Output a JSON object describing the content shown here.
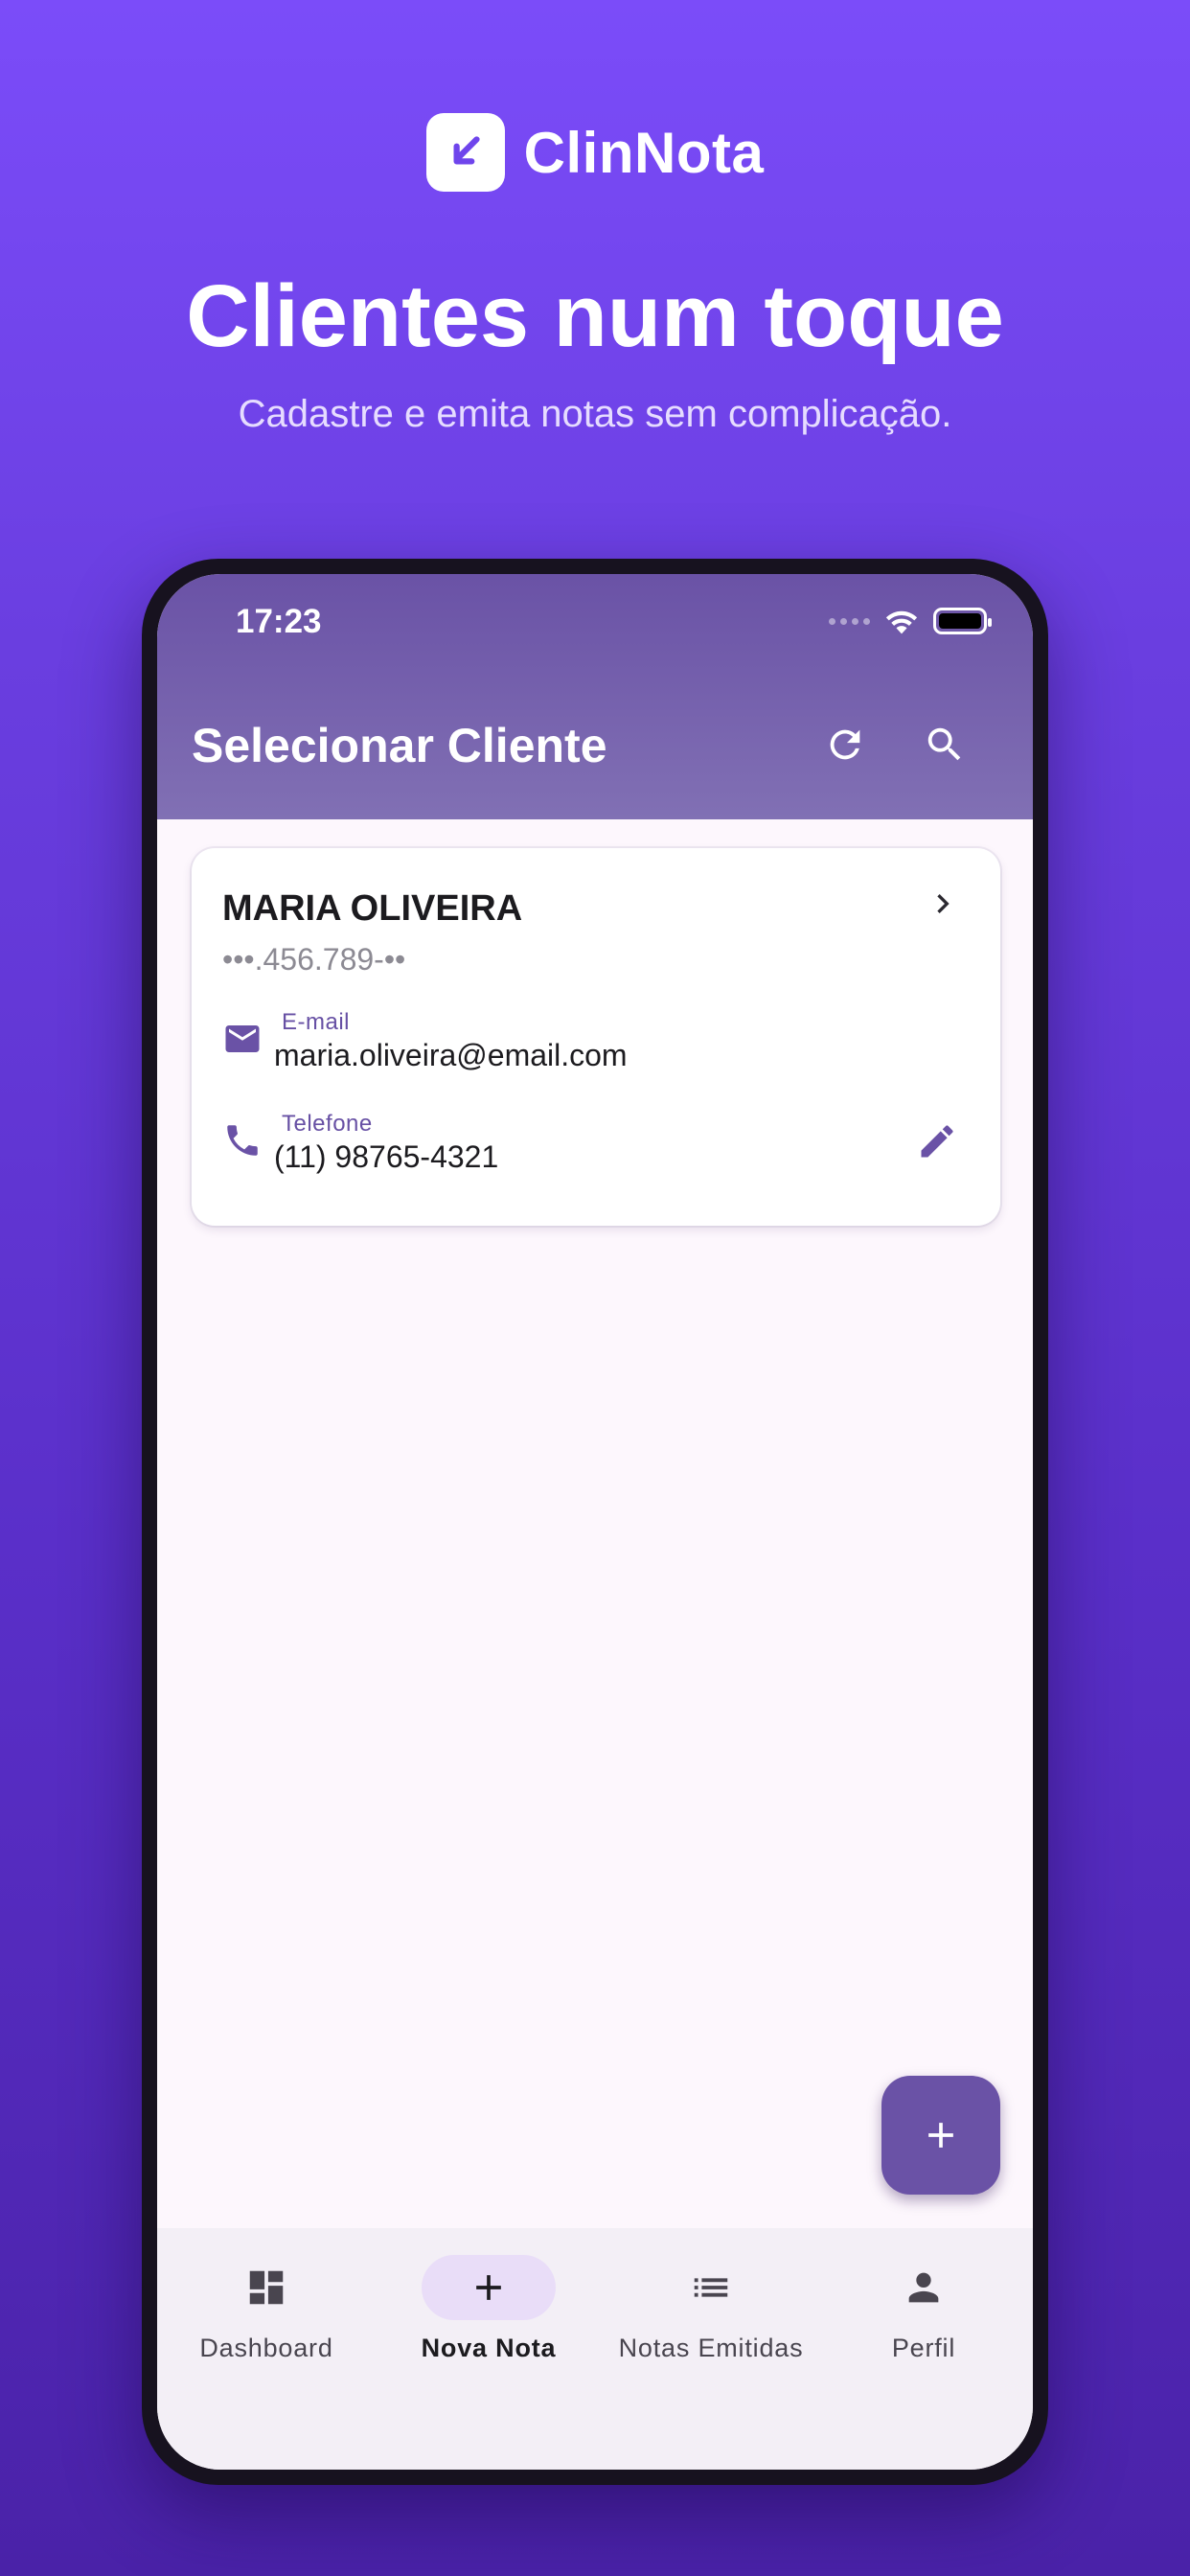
{
  "brand": {
    "name": "ClinNota"
  },
  "hero": {
    "headline": "Clientes num toque",
    "subheadline": "Cadastre e emita notas sem complicação."
  },
  "status_bar": {
    "time": "17:23"
  },
  "app_bar": {
    "title": "Selecionar Cliente",
    "actions": [
      "refresh-icon",
      "search-icon"
    ]
  },
  "client": {
    "name": "MARIA OLIVEIRA",
    "document": "•••.456.789-••",
    "email_label": "E-mail",
    "email": "maria.oliveira@email.com",
    "phone_label": "Telefone",
    "phone": "(11) 98765-4321"
  },
  "fab": {
    "icon": "plus-icon"
  },
  "bottom_nav": {
    "items": [
      {
        "label": "Dashboard",
        "icon": "dashboard-icon",
        "active": false
      },
      {
        "label": "Nova Nota",
        "icon": "plus-icon",
        "active": true
      },
      {
        "label": "Notas Emitidas",
        "icon": "list-icon",
        "active": false
      },
      {
        "label": "Perfil",
        "icon": "person-icon",
        "active": false
      }
    ]
  },
  "colors": {
    "primary": "#6a52a6",
    "background_gradient_top": "#7b4cf9",
    "background_gradient_bottom": "#4a22a8",
    "surface": "#fdf7fd",
    "nav_active_pill": "#e9ddf8"
  }
}
